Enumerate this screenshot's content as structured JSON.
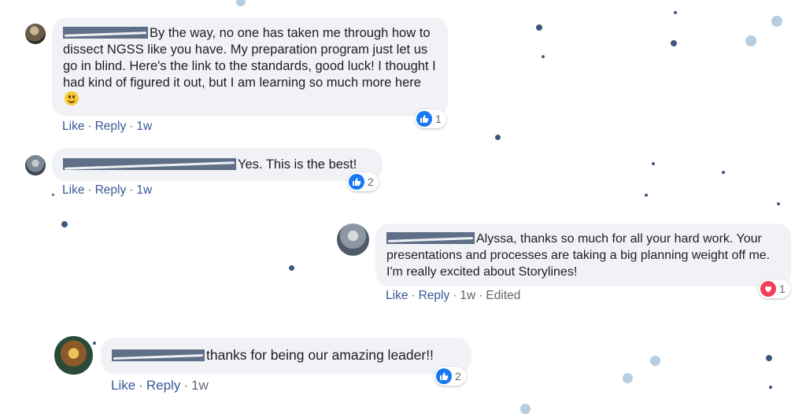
{
  "comments": [
    {
      "text": "By the way, no one has taken me through how to dissect NGSS like you have. My preparation program just let us go in blind. Here's the link to the standards, good luck! I thought I had kind of figured it out, but I am learning so much more here",
      "emoji": "slightly-smiling-face-icon",
      "actions": {
        "like": "Like",
        "reply": "Reply",
        "time": "1w"
      },
      "reaction": {
        "type": "like-icon",
        "count": "1"
      }
    },
    {
      "text": "Yes. This is the best!",
      "actions": {
        "like": "Like",
        "reply": "Reply",
        "time": "1w"
      },
      "reaction": {
        "type": "like-icon",
        "count": "2"
      }
    },
    {
      "text": "Alyssa, thanks so much for all your hard work. Your presentations and processes are taking a big planning weight off me. I'm really excited about Storylines!",
      "actions": {
        "like": "Like",
        "reply": "Reply",
        "time": "1w",
        "edited": "Edited"
      },
      "reaction": {
        "type": "love-icon",
        "count": "1"
      }
    },
    {
      "text": "thanks for being our amazing leader!!",
      "actions": {
        "like": "Like",
        "reply": "Reply",
        "time": "1w"
      },
      "reaction": {
        "type": "like-icon",
        "count": "2"
      }
    }
  ],
  "colors": {
    "bubble": "#f0f2f5",
    "link": "#385898",
    "like": "#1877f2",
    "love": "#f33e58",
    "redaction": "#5f6f87",
    "confetti_dark": "#3d5a7e",
    "confetti_light": "#b7cde0"
  }
}
